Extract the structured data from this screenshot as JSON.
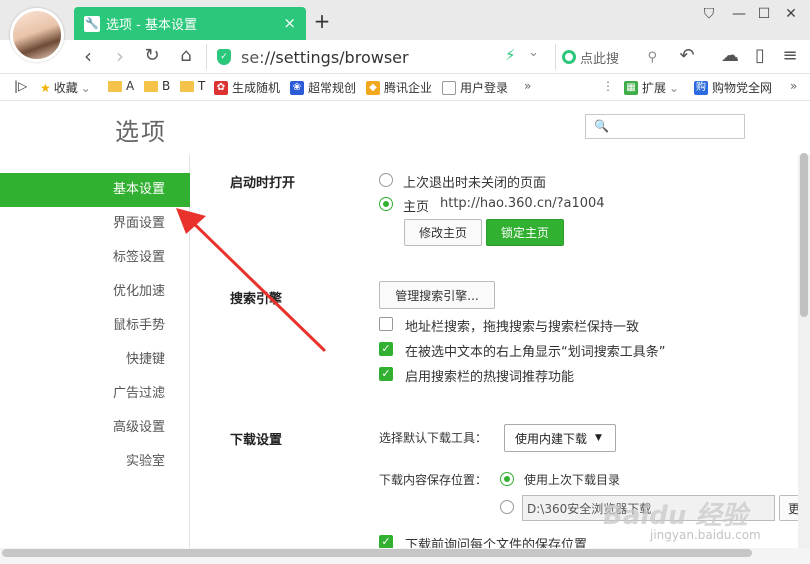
{
  "tab": {
    "title": "选项 - 基本设置",
    "close": "×",
    "new": "+"
  },
  "window": {
    "skin": "⛉",
    "minimize": "—",
    "maximize": "☐",
    "close": "✕"
  },
  "nav": {
    "back": "‹",
    "forward": "›",
    "reload": "↻",
    "home": "⌂"
  },
  "address": {
    "scheme": "se:",
    "path": "//settings/browser"
  },
  "search": {
    "placeholder": "点此搜"
  },
  "toolbar_right": {
    "undo": "↶",
    "cloud": "☁",
    "phone": "▯",
    "menu": "≡"
  },
  "bookmarks": [
    {
      "label": "收藏",
      "icon": "star-icon"
    },
    {
      "label": "A",
      "icon": "folder-icon"
    },
    {
      "label": "B",
      "icon": "folder-icon"
    },
    {
      "label": "T",
      "icon": "folder-icon"
    },
    {
      "label": "生成随机",
      "icon": "site-icon"
    },
    {
      "label": "超常规创",
      "icon": "paw-icon"
    },
    {
      "label": "腾讯企业",
      "icon": "tencent-icon"
    },
    {
      "label": "用户登录",
      "icon": "page-icon"
    }
  ],
  "bookmarks_right": [
    {
      "label": "扩展",
      "icon": "extension-icon"
    },
    {
      "label": "购物党全网",
      "icon": "shop-icon"
    }
  ],
  "page": {
    "title": "选项",
    "search_placeholder": ""
  },
  "sidebar": [
    {
      "label": "基本设置",
      "active": true
    },
    {
      "label": "界面设置"
    },
    {
      "label": "标签设置"
    },
    {
      "label": "优化加速"
    },
    {
      "label": "鼠标手势"
    },
    {
      "label": "快捷键"
    },
    {
      "label": "广告过滤"
    },
    {
      "label": "高级设置"
    },
    {
      "label": "实验室"
    }
  ],
  "startup": {
    "heading": "启动时打开",
    "option1": "上次退出时未关闭的页面",
    "option2_label": "主页",
    "homepage_url": "http://hao.360.cn/?a1004",
    "btn_modify": "修改主页",
    "btn_lock": "锁定主页"
  },
  "search_engine": {
    "heading": "搜索引擎",
    "manage_btn": "管理搜索引擎...",
    "opt1": "地址栏搜索，拖拽搜索与搜索栏保持一致",
    "opt2": "在被选中文本的右上角显示“划词搜索工具条”",
    "opt3": "启用搜索栏的热搜词推荐功能"
  },
  "download": {
    "heading": "下载设置",
    "tool_label": "选择默认下载工具：",
    "tool_value": "使用内建下载",
    "location_label": "下载内容保存位置：",
    "location_opt1": "使用上次下载目录",
    "path_value": "D:\\360安全浏览器下载",
    "change_btn": "更",
    "ask_each": "下载前询问每个文件的保存位置"
  },
  "watermark": {
    "text": "Baidu 经验",
    "sub": "jingyan.baidu.com"
  }
}
